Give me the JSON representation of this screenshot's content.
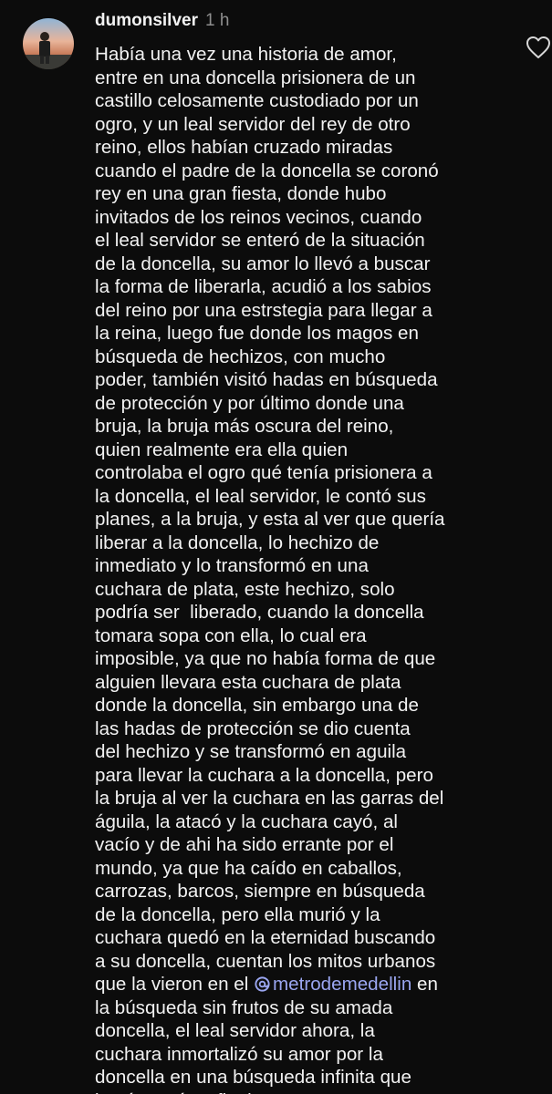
{
  "comment": {
    "username": "dumonsilver",
    "time": "1 h",
    "lines_before": [
      "Había una vez una historia de amor,",
      "entre en una doncella prisionera de un",
      "castillo celosamente custodiado por un",
      "ogro, y un leal servidor del rey de otro",
      "reino, ellos habían cruzado miradas",
      "cuando el padre de la doncella se coronó",
      "rey en una gran fiesta, donde hubo",
      "invitados de los reinos vecinos, cuando",
      "el leal servidor se enteró de la situación",
      "de la doncella, su amor lo llevó a buscar",
      "la forma de liberarla, acudió a los sabios",
      "del reino por una estrstegia para llegar a",
      "la reina, luego fue donde los magos en",
      "búsqueda de hechizos, con mucho",
      "poder, también visitó hadas en búsqueda",
      "de protección y por último donde una",
      "bruja, la bruja más oscura del reino,",
      "quien realmente era ella quien",
      "controlaba el ogro qué tenía prisionera a",
      "la doncella, el leal servidor, le contó sus",
      "planes, a la bruja, y esta al ver que quería",
      "liberar a la doncella, lo hechizo de",
      "inmediato y lo transformó en una",
      "cuchara de plata, este hechizo, solo",
      "podría ser  liberado, cuando la doncella",
      "tomara sopa con ella, lo cual era",
      "imposible, ya que no había forma de que",
      "alguien llevara esta cuchara de plata",
      "donde la doncella, sin embargo una de",
      "las hadas de protección se dio cuenta",
      "del hechizo y se transformó en aguila",
      "para llevar la cuchara a la doncella, pero",
      "la bruja al ver la cuchara en las garras del",
      "águila, la atacó y la cuchara cayó, al",
      "vacío y de ahi ha sido errante por el",
      "mundo, ya que ha caído en caballos,",
      "carrozas, barcos, siempre en búsqueda",
      "de la doncella, pero ella murió y la",
      "cuchara quedó en la eternidad buscando",
      "a su doncella, cuentan los mitos urbanos"
    ],
    "mention_line": {
      "before": "que la vieron en el ",
      "mention": "metrodemedellin",
      "after": " en"
    },
    "lines_after": [
      "la búsqueda sin frutos de su amada",
      "doncella, el leal servidor ahora, la",
      "cuchara inmortalizó su amor por la",
      "doncella en una búsqueda infinita que",
      "jamás verá su final."
    ]
  },
  "icons": {
    "like": "heart-outline-icon",
    "mention": "threads-at-icon"
  },
  "colors": {
    "background": "#0c0c0c",
    "text": "#f2f2f2",
    "muted": "#8e8e8e",
    "mention": "#9aa6f0"
  }
}
